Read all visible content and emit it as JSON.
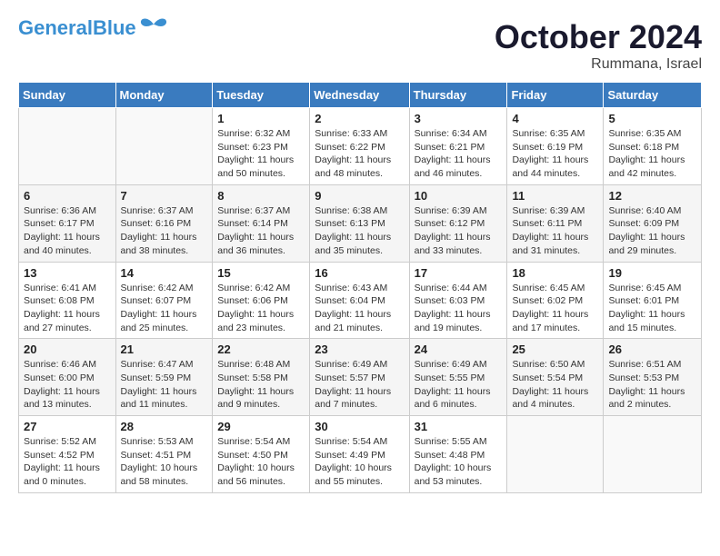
{
  "header": {
    "logo_general": "General",
    "logo_blue": "Blue",
    "month": "October 2024",
    "location": "Rummana, Israel"
  },
  "weekdays": [
    "Sunday",
    "Monday",
    "Tuesday",
    "Wednesday",
    "Thursday",
    "Friday",
    "Saturday"
  ],
  "weeks": [
    [
      {
        "day": "",
        "info": ""
      },
      {
        "day": "",
        "info": ""
      },
      {
        "day": "1",
        "info": "Sunrise: 6:32 AM\nSunset: 6:23 PM\nDaylight: 11 hours and 50 minutes."
      },
      {
        "day": "2",
        "info": "Sunrise: 6:33 AM\nSunset: 6:22 PM\nDaylight: 11 hours and 48 minutes."
      },
      {
        "day": "3",
        "info": "Sunrise: 6:34 AM\nSunset: 6:21 PM\nDaylight: 11 hours and 46 minutes."
      },
      {
        "day": "4",
        "info": "Sunrise: 6:35 AM\nSunset: 6:19 PM\nDaylight: 11 hours and 44 minutes."
      },
      {
        "day": "5",
        "info": "Sunrise: 6:35 AM\nSunset: 6:18 PM\nDaylight: 11 hours and 42 minutes."
      }
    ],
    [
      {
        "day": "6",
        "info": "Sunrise: 6:36 AM\nSunset: 6:17 PM\nDaylight: 11 hours and 40 minutes."
      },
      {
        "day": "7",
        "info": "Sunrise: 6:37 AM\nSunset: 6:16 PM\nDaylight: 11 hours and 38 minutes."
      },
      {
        "day": "8",
        "info": "Sunrise: 6:37 AM\nSunset: 6:14 PM\nDaylight: 11 hours and 36 minutes."
      },
      {
        "day": "9",
        "info": "Sunrise: 6:38 AM\nSunset: 6:13 PM\nDaylight: 11 hours and 35 minutes."
      },
      {
        "day": "10",
        "info": "Sunrise: 6:39 AM\nSunset: 6:12 PM\nDaylight: 11 hours and 33 minutes."
      },
      {
        "day": "11",
        "info": "Sunrise: 6:39 AM\nSunset: 6:11 PM\nDaylight: 11 hours and 31 minutes."
      },
      {
        "day": "12",
        "info": "Sunrise: 6:40 AM\nSunset: 6:09 PM\nDaylight: 11 hours and 29 minutes."
      }
    ],
    [
      {
        "day": "13",
        "info": "Sunrise: 6:41 AM\nSunset: 6:08 PM\nDaylight: 11 hours and 27 minutes."
      },
      {
        "day": "14",
        "info": "Sunrise: 6:42 AM\nSunset: 6:07 PM\nDaylight: 11 hours and 25 minutes."
      },
      {
        "day": "15",
        "info": "Sunrise: 6:42 AM\nSunset: 6:06 PM\nDaylight: 11 hours and 23 minutes."
      },
      {
        "day": "16",
        "info": "Sunrise: 6:43 AM\nSunset: 6:04 PM\nDaylight: 11 hours and 21 minutes."
      },
      {
        "day": "17",
        "info": "Sunrise: 6:44 AM\nSunset: 6:03 PM\nDaylight: 11 hours and 19 minutes."
      },
      {
        "day": "18",
        "info": "Sunrise: 6:45 AM\nSunset: 6:02 PM\nDaylight: 11 hours and 17 minutes."
      },
      {
        "day": "19",
        "info": "Sunrise: 6:45 AM\nSunset: 6:01 PM\nDaylight: 11 hours and 15 minutes."
      }
    ],
    [
      {
        "day": "20",
        "info": "Sunrise: 6:46 AM\nSunset: 6:00 PM\nDaylight: 11 hours and 13 minutes."
      },
      {
        "day": "21",
        "info": "Sunrise: 6:47 AM\nSunset: 5:59 PM\nDaylight: 11 hours and 11 minutes."
      },
      {
        "day": "22",
        "info": "Sunrise: 6:48 AM\nSunset: 5:58 PM\nDaylight: 11 hours and 9 minutes."
      },
      {
        "day": "23",
        "info": "Sunrise: 6:49 AM\nSunset: 5:57 PM\nDaylight: 11 hours and 7 minutes."
      },
      {
        "day": "24",
        "info": "Sunrise: 6:49 AM\nSunset: 5:55 PM\nDaylight: 11 hours and 6 minutes."
      },
      {
        "day": "25",
        "info": "Sunrise: 6:50 AM\nSunset: 5:54 PM\nDaylight: 11 hours and 4 minutes."
      },
      {
        "day": "26",
        "info": "Sunrise: 6:51 AM\nSunset: 5:53 PM\nDaylight: 11 hours and 2 minutes."
      }
    ],
    [
      {
        "day": "27",
        "info": "Sunrise: 5:52 AM\nSunset: 4:52 PM\nDaylight: 11 hours and 0 minutes."
      },
      {
        "day": "28",
        "info": "Sunrise: 5:53 AM\nSunset: 4:51 PM\nDaylight: 10 hours and 58 minutes."
      },
      {
        "day": "29",
        "info": "Sunrise: 5:54 AM\nSunset: 4:50 PM\nDaylight: 10 hours and 56 minutes."
      },
      {
        "day": "30",
        "info": "Sunrise: 5:54 AM\nSunset: 4:49 PM\nDaylight: 10 hours and 55 minutes."
      },
      {
        "day": "31",
        "info": "Sunrise: 5:55 AM\nSunset: 4:48 PM\nDaylight: 10 hours and 53 minutes."
      },
      {
        "day": "",
        "info": ""
      },
      {
        "day": "",
        "info": ""
      }
    ]
  ]
}
